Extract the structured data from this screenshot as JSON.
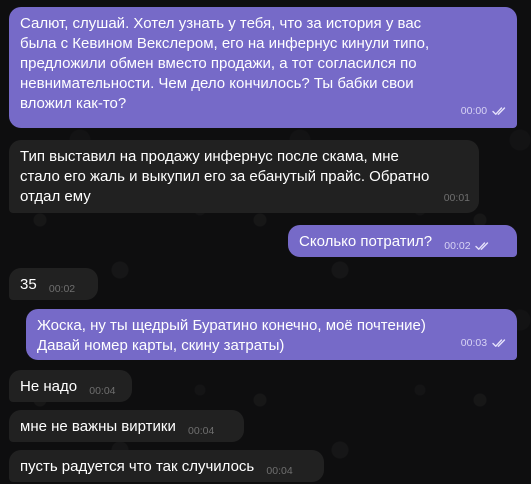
{
  "messages": [
    {
      "direction": "out",
      "text": "Салют, слушай. Хотел узнать у тебя, что за история у вас\nбыла с Кевином Векслером, его на инфернус кинули типо,\nпредложили обмен вместо продажи, а тот согласился по\nневнимательности. Чем дело кончилось? Ты бабки свои\nвложил как-то?",
      "time": "00:00",
      "status_icon": "double-check-icon"
    },
    {
      "direction": "in",
      "text": "Тип выставил на продажу инфернус после скама, мне\nстало его жаль и выкупил его за ебанутый прайс. Обратно\nотдал ему",
      "time": "00:01"
    },
    {
      "direction": "out",
      "text": "Сколько потратил?",
      "time": "00:02",
      "status_icon": "double-check-icon"
    },
    {
      "direction": "in",
      "text": "35",
      "time": "00:02"
    },
    {
      "direction": "out",
      "text": "Жоска, ну ты щедрый Буратино конечно, моё почтение)\nДавай номер карты, скину затраты)",
      "time": "00:03",
      "status_icon": "double-check-icon"
    },
    {
      "direction": "in",
      "text": "Не надо",
      "time": "00:04"
    },
    {
      "direction": "in",
      "text": "мне не важны виртики",
      "time": "00:04"
    },
    {
      "direction": "in",
      "text": "пусть радуется что так случилось",
      "time": "00:04"
    }
  ]
}
